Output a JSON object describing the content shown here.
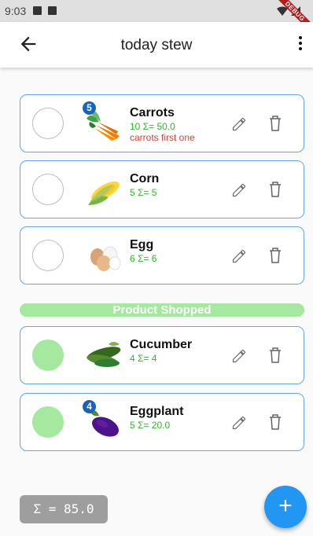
{
  "status_bar": {
    "time": "9:03"
  },
  "debug_banner": "DEBUG",
  "app_bar": {
    "title": "today stew",
    "back_icon": "arrow-left-icon",
    "menu_icon": "more-vert-icon"
  },
  "items": [
    {
      "name": "Carrots",
      "quantity": "10  Σ= 50.0",
      "note": "carrots first one",
      "badge": "5",
      "checked": false,
      "image": "carrot-image"
    },
    {
      "name": "Corn",
      "quantity": "5  Σ= 5",
      "note": "",
      "badge": "",
      "checked": false,
      "image": "corn-image"
    },
    {
      "name": "Egg",
      "quantity": "6  Σ= 6",
      "note": "",
      "badge": "",
      "checked": false,
      "image": "egg-image"
    }
  ],
  "shopped_header": "Product Shopped",
  "shopped_items": [
    {
      "name": "Cucumber",
      "quantity": "4  Σ= 4",
      "note": "",
      "badge": "",
      "checked": true,
      "image": "cucumber-image"
    },
    {
      "name": "Eggplant",
      "quantity": "5  Σ= 20.0",
      "note": "",
      "badge": "4",
      "checked": true,
      "image": "eggplant-image"
    }
  ],
  "total": "Σ = 85.0",
  "fab_label": "+",
  "colors": {
    "accent": "#2196f3",
    "checked_fill": "#a5e89f",
    "quantity_green": "#2eb82e",
    "note_red": "#e53935",
    "card_border": "#64a5e6"
  }
}
